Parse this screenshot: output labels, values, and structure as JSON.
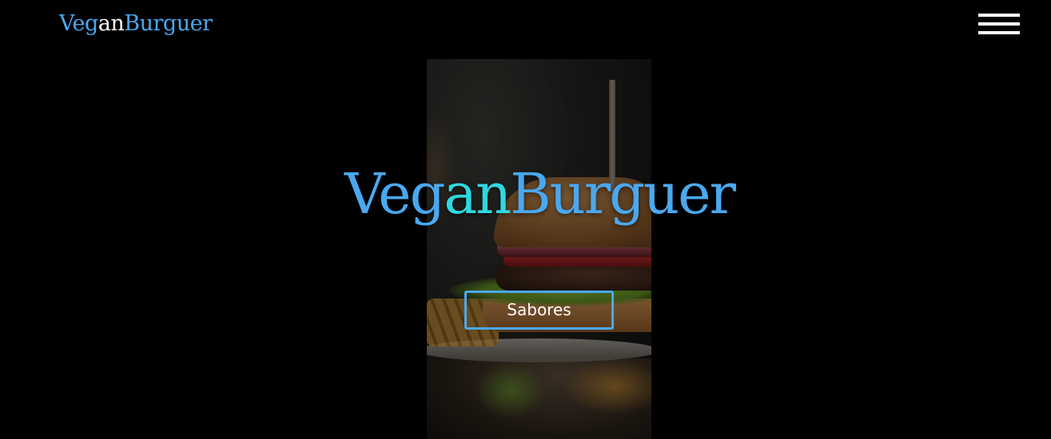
{
  "header": {
    "logo": {
      "part1": "Veg",
      "part2": "an",
      "part3": "Burguer"
    },
    "menu_icon": "hamburger-menu-icon"
  },
  "hero": {
    "title": {
      "part1": "Veg",
      "part2": "an",
      "part3": "Burguer"
    },
    "cta_label": "Sabores"
  },
  "colors": {
    "background": "#000000",
    "accent_blue": "#4aa8f0",
    "accent_cyan": "#2fd8e0",
    "text_white": "#ffffff"
  }
}
